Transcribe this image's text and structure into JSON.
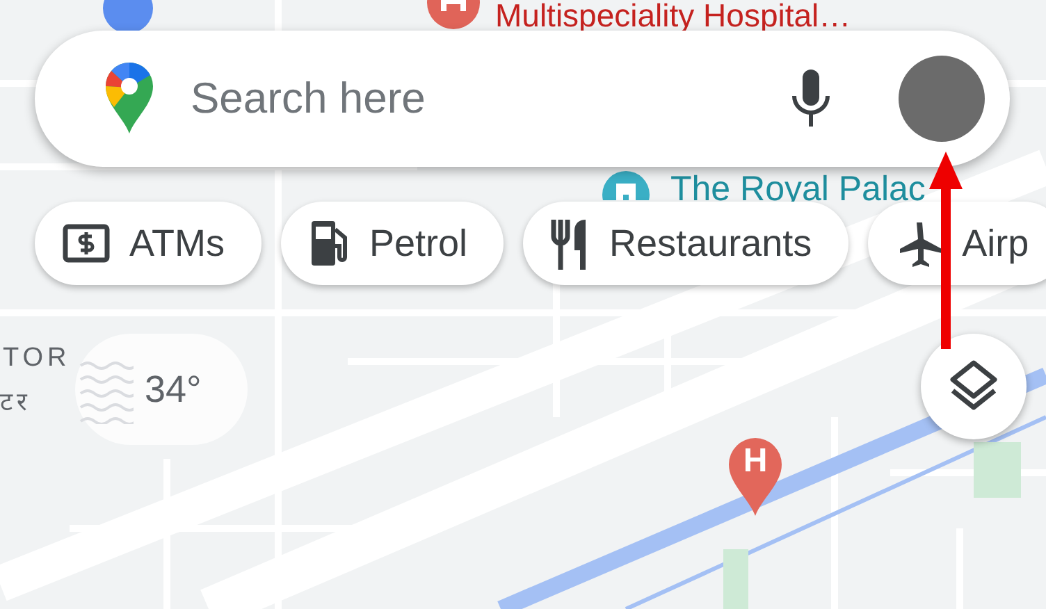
{
  "map": {
    "labels": [
      {
        "text": "Multispeciality Hospital…",
        "kind": "hospital"
      },
      {
        "text": "The Royal Palac",
        "kind": "landmark"
      },
      {
        "text": "TOR",
        "kind": "area"
      },
      {
        "text": "टर",
        "kind": "area"
      }
    ],
    "pins": [
      {
        "label": "H",
        "kind": "hospital"
      }
    ]
  },
  "search": {
    "placeholder": "Search here"
  },
  "chips": [
    {
      "label": "ATMs",
      "kind": "atm"
    },
    {
      "label": "Petrol",
      "kind": "petrol"
    },
    {
      "label": "Restaurants",
      "kind": "restaurant"
    },
    {
      "label": "Airp",
      "kind": "plane"
    }
  ],
  "weather": {
    "temperature": "34°"
  }
}
